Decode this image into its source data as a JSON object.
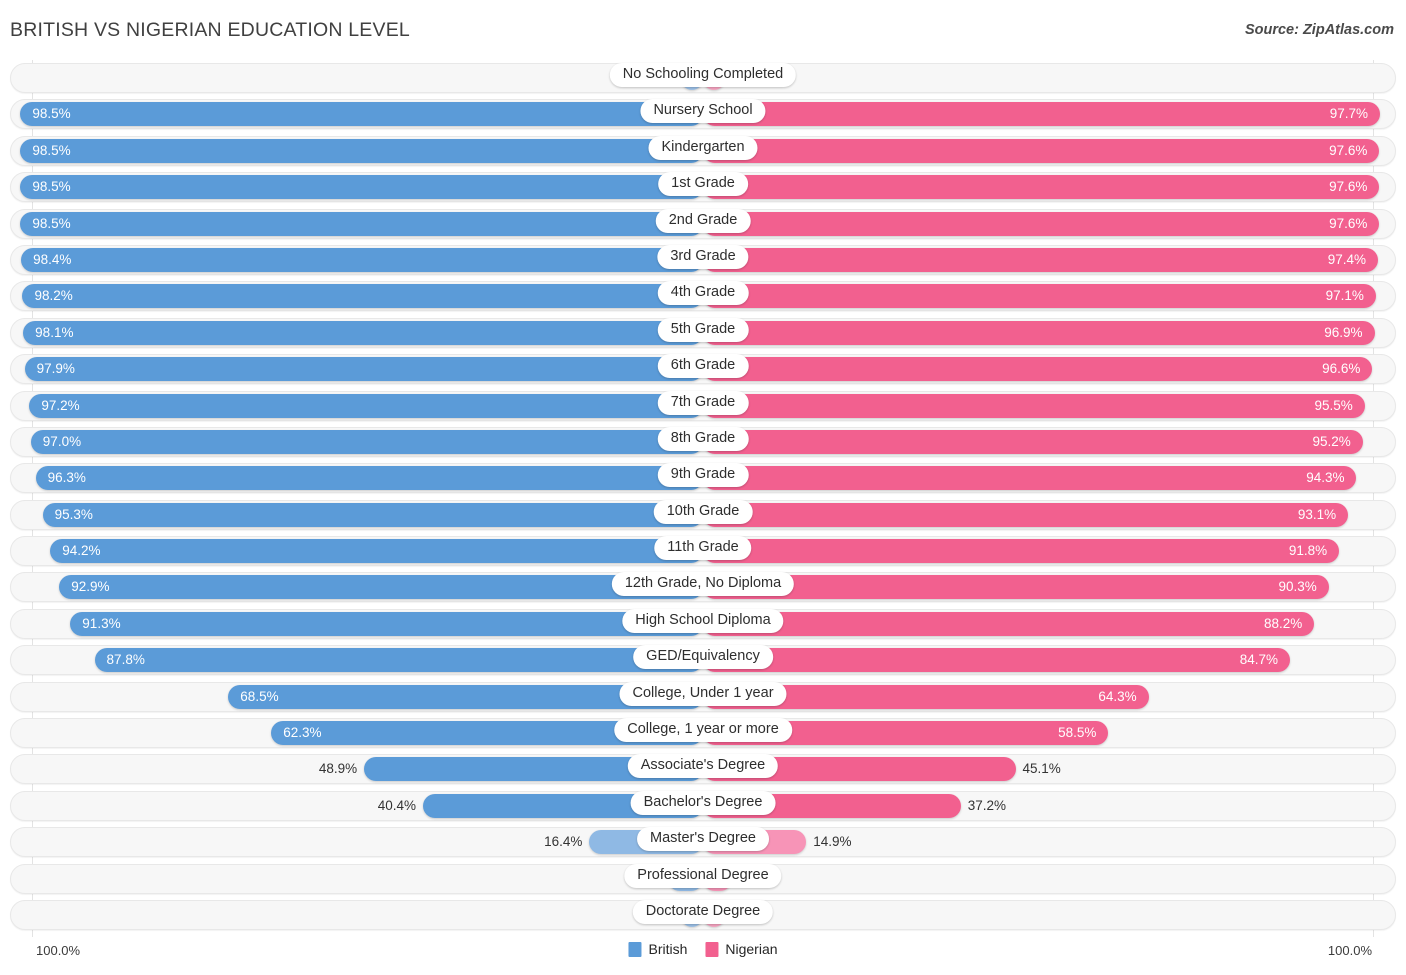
{
  "header": {
    "title": "BRITISH VS NIGERIAN EDUCATION LEVEL",
    "source": "Source: ZipAtlas.com"
  },
  "footer": {
    "axis_left": "100.0%",
    "axis_right": "100.0%",
    "legend": [
      {
        "label": "British",
        "color": "#5b9bd8"
      },
      {
        "label": "Nigerian",
        "color": "#f2608f"
      }
    ]
  },
  "colors": {
    "british": "#5b9bd8",
    "nigerian": "#f2608f",
    "british_light": "#8fb9e4",
    "nigerian_light": "#f794b7",
    "track": "#f7f7f7",
    "gridline": "#e3e3e3"
  },
  "chart_data": {
    "type": "bar",
    "orientation": "horizontal-diverging",
    "title": "BRITISH VS NIGERIAN EDUCATION LEVEL",
    "xlabel": "",
    "ylabel": "",
    "xlim": [
      0,
      100
    ],
    "grid": true,
    "legend_position": "bottom-center",
    "axis_max_label": "100.0%",
    "categories": [
      "No Schooling Completed",
      "Nursery School",
      "Kindergarten",
      "1st Grade",
      "2nd Grade",
      "3rd Grade",
      "4th Grade",
      "5th Grade",
      "6th Grade",
      "7th Grade",
      "8th Grade",
      "9th Grade",
      "10th Grade",
      "11th Grade",
      "12th Grade, No Diploma",
      "High School Diploma",
      "GED/Equivalency",
      "College, Under 1 year",
      "College, 1 year or more",
      "Associate's Degree",
      "Bachelor's Degree",
      "Master's Degree",
      "Professional Degree",
      "Doctorate Degree"
    ],
    "series": [
      {
        "name": "British",
        "side": "left",
        "color": "#5b9bd8",
        "values": [
          1.5,
          98.5,
          98.5,
          98.5,
          98.5,
          98.4,
          98.2,
          98.1,
          97.9,
          97.2,
          97.0,
          96.3,
          95.3,
          94.2,
          92.9,
          91.3,
          87.8,
          68.5,
          62.3,
          48.9,
          40.4,
          16.4,
          5.0,
          2.2
        ],
        "labels": [
          "1.5%",
          "98.5%",
          "98.5%",
          "98.5%",
          "98.5%",
          "98.4%",
          "98.2%",
          "98.1%",
          "97.9%",
          "97.2%",
          "97.0%",
          "96.3%",
          "95.3%",
          "94.2%",
          "92.9%",
          "91.3%",
          "87.8%",
          "68.5%",
          "62.3%",
          "48.9%",
          "40.4%",
          "16.4%",
          "5.0%",
          "2.2%"
        ]
      },
      {
        "name": "Nigerian",
        "side": "right",
        "color": "#f2608f",
        "values": [
          2.3,
          97.7,
          97.6,
          97.6,
          97.6,
          97.4,
          97.1,
          96.9,
          96.6,
          95.5,
          95.2,
          94.3,
          93.1,
          91.8,
          90.3,
          88.2,
          84.7,
          64.3,
          58.5,
          45.1,
          37.2,
          14.9,
          4.2,
          1.8
        ],
        "labels": [
          "2.3%",
          "97.7%",
          "97.6%",
          "97.6%",
          "97.6%",
          "97.4%",
          "97.1%",
          "96.9%",
          "96.6%",
          "95.5%",
          "95.2%",
          "94.3%",
          "93.1%",
          "91.8%",
          "90.3%",
          "88.2%",
          "84.7%",
          "64.3%",
          "58.5%",
          "45.1%",
          "37.2%",
          "14.9%",
          "4.2%",
          "1.8%"
        ]
      }
    ]
  }
}
